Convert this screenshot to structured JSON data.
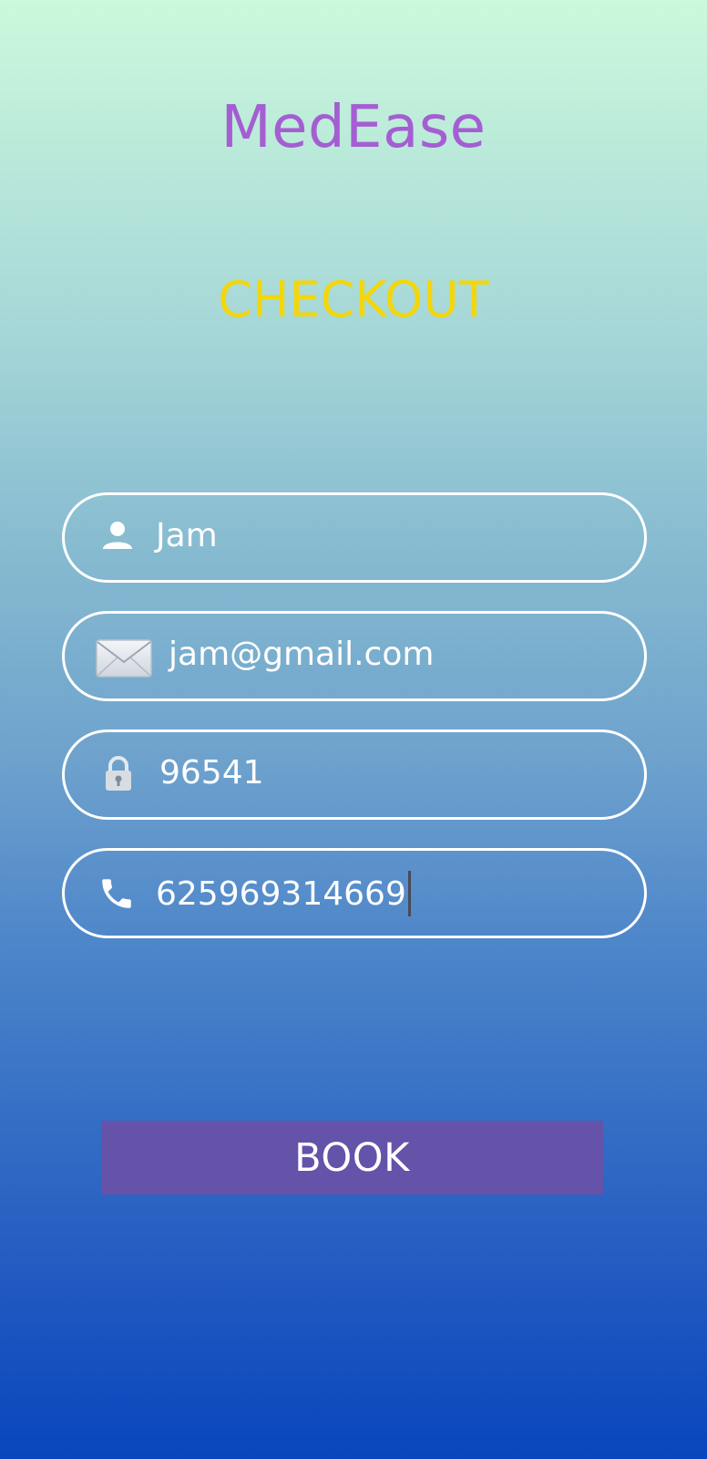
{
  "app": {
    "title": "MedEase"
  },
  "screen": {
    "title": "CHECKOUT"
  },
  "form": {
    "name": {
      "value": "Jam",
      "icon": "person-icon"
    },
    "email": {
      "value": "jam@gmail.com",
      "icon": "envelope-icon"
    },
    "password": {
      "value": "96541",
      "icon": "lock-icon"
    },
    "phone": {
      "value": "625969314669",
      "icon": "phone-icon"
    }
  },
  "actions": {
    "book_label": "BOOK"
  },
  "colors": {
    "title": "#a45ed2",
    "heading": "#f3d60b",
    "button": "#6552a9"
  }
}
